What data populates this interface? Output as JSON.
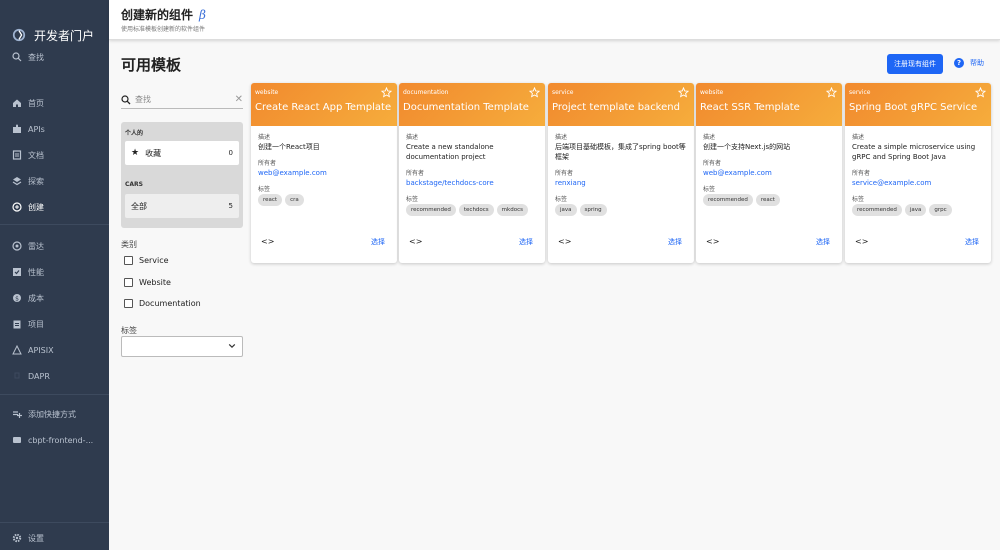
{
  "sidebar": {
    "brand": "开发者门户",
    "search": "查找",
    "items": [
      {
        "label": "首页",
        "icon": "home-icon"
      },
      {
        "label": "APIs",
        "icon": "puzzle-icon"
      },
      {
        "label": "文档",
        "icon": "docs-icon"
      },
      {
        "label": "探索",
        "icon": "layers-icon"
      },
      {
        "label": "创建",
        "icon": "add-circle-icon"
      },
      {
        "label": "雷达",
        "icon": "radar-icon"
      },
      {
        "label": "性能",
        "icon": "checklist-icon"
      },
      {
        "label": "成本",
        "icon": "money-icon"
      },
      {
        "label": "项目",
        "icon": "clipboard-icon"
      },
      {
        "label": "APISIX",
        "icon": "apisix-icon"
      },
      {
        "label": "DAPR",
        "icon": "dapr-icon"
      },
      {
        "label": "添加快捷方式",
        "icon": "playlist-add-icon"
      },
      {
        "label": "cbpt-frontend-...",
        "icon": "shortcut-icon"
      }
    ],
    "settings": "设置"
  },
  "header": {
    "title": "创建新的组件",
    "beta": "β",
    "subtitle": "使用标准模板创建新的软件组件"
  },
  "main": {
    "title": "可用模板",
    "register_button": "注册现有组件",
    "help": "帮助"
  },
  "filters": {
    "search_placeholder": "查找",
    "personal_group": "个人的",
    "favorites_label": "收藏",
    "favorites_count": "0",
    "cars_group": "CARS",
    "all_label": "全部",
    "all_count": "5",
    "category_label": "类别",
    "categories": [
      "Service",
      "Website",
      "Documentation"
    ],
    "tags_label": "标签"
  },
  "cards_labels": {
    "description": "描述",
    "owner": "所有者",
    "tags": "标签",
    "choose": "选择",
    "code": "<>"
  },
  "cards": [
    {
      "type": "website",
      "title": "Create React App Template",
      "description": "创建一个React项目",
      "owner": "web@example.com",
      "tags": [
        "react",
        "cra"
      ]
    },
    {
      "type": "documentation",
      "title": "Documentation Template",
      "description": "Create a new standalone documentation project",
      "owner": "backstage/techdocs-core",
      "tags": [
        "recommended",
        "techdocs",
        "mkdocs"
      ]
    },
    {
      "type": "service",
      "title": "Project template backend",
      "description": "后端项目基础模板，集成了spring boot等框架",
      "owner": "renxiang",
      "tags": [
        "java",
        "spring"
      ]
    },
    {
      "type": "website",
      "title": "React SSR Template",
      "description": "创建一个支持Next.js的网站",
      "owner": "web@example.com",
      "tags": [
        "recommended",
        "react"
      ]
    },
    {
      "type": "service",
      "title": "Spring Boot gRPC Service",
      "description": "Create a simple microservice using gRPC and Spring Boot Java",
      "owner": "service@example.com",
      "tags": [
        "recommended",
        "java",
        "grpc"
      ]
    }
  ],
  "colors": {
    "sidebar_bg": "#2f3b4e",
    "accent": "#1e66f5",
    "card_header": "#f39b35"
  }
}
